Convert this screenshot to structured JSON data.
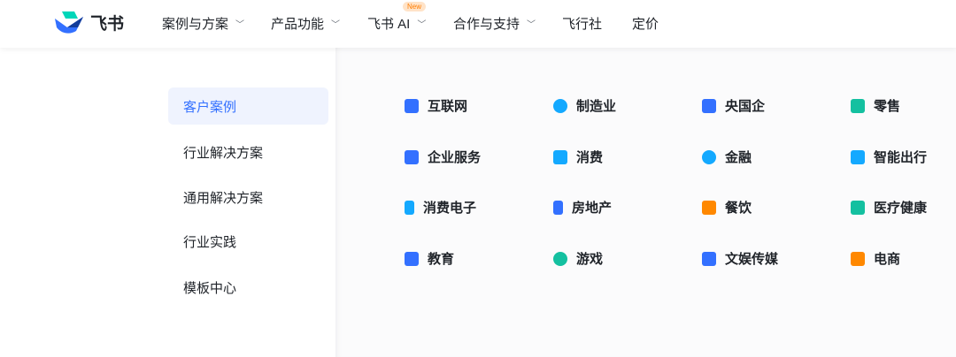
{
  "header": {
    "logo_text": "飞书",
    "nav": [
      {
        "label": "案例与方案",
        "dropdown": true
      },
      {
        "label": "产品功能",
        "dropdown": true
      },
      {
        "label": "飞书 AI",
        "dropdown": true,
        "badge": "New"
      },
      {
        "label": "合作与支持",
        "dropdown": true
      },
      {
        "label": "飞行社",
        "dropdown": false
      },
      {
        "label": "定价",
        "dropdown": false
      }
    ]
  },
  "sidebar": {
    "items": [
      {
        "label": "客户案例",
        "active": true
      },
      {
        "label": "行业解决方案"
      },
      {
        "label": "通用解决方案"
      },
      {
        "label": "行业实践"
      },
      {
        "label": "模板中心"
      }
    ]
  },
  "categories": [
    {
      "label": "互联网",
      "icon": "monitor-icon",
      "color": "#3370ff"
    },
    {
      "label": "制造业",
      "icon": "planet-icon",
      "color": "#14a9ff"
    },
    {
      "label": "央国企",
      "icon": "bank-icon",
      "color": "#3370ff"
    },
    {
      "label": "零售",
      "icon": "shopping-bag-icon",
      "color": "#14c0a0"
    },
    {
      "label": "企业服务",
      "icon": "briefcase-icon",
      "color": "#3370ff"
    },
    {
      "label": "消费",
      "icon": "basket-icon",
      "color": "#14a9ff"
    },
    {
      "label": "金融",
      "icon": "yuan-icon",
      "color": "#14a9ff"
    },
    {
      "label": "智能出行",
      "icon": "rocket-icon",
      "color": "#14a9ff"
    },
    {
      "label": "消费电子",
      "icon": "phone-icon",
      "color": "#14a9ff"
    },
    {
      "label": "房地产",
      "icon": "building-icon",
      "color": "#3370ff"
    },
    {
      "label": "餐饮",
      "icon": "burger-icon",
      "color": "#ff8800"
    },
    {
      "label": "医疗健康",
      "icon": "medical-kit-icon",
      "color": "#14c0a0"
    },
    {
      "label": "教育",
      "icon": "book-icon",
      "color": "#3370ff"
    },
    {
      "label": "游戏",
      "icon": "smile-icon",
      "color": "#14c0a0"
    },
    {
      "label": "文娱传媒",
      "icon": "video-icon",
      "color": "#3370ff"
    },
    {
      "label": "电商",
      "icon": "tag-icon",
      "color": "#ff8800"
    }
  ]
}
